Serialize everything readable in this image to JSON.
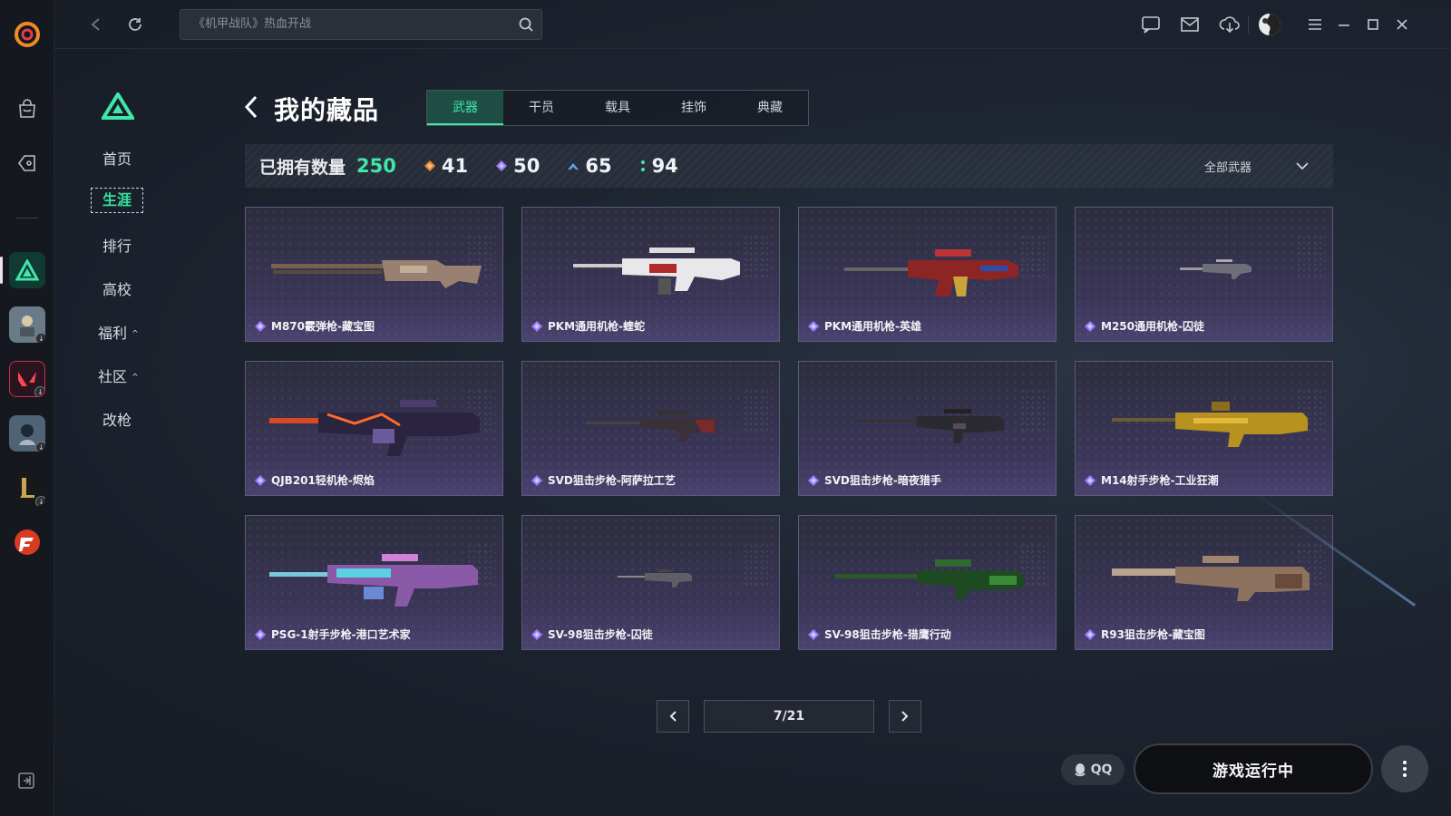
{
  "search": {
    "placeholder": "《机甲战队》热血开战"
  },
  "sidebar_nav": [
    {
      "label": "首页"
    },
    {
      "label": "生涯",
      "active": true
    },
    {
      "label": "排行"
    },
    {
      "label": "高校"
    },
    {
      "label": "福利",
      "expandable": true
    },
    {
      "label": "社区",
      "expandable": true
    },
    {
      "label": "改枪"
    }
  ],
  "header": {
    "title": "我的藏品"
  },
  "tabs": [
    {
      "label": "武器",
      "active": true
    },
    {
      "label": "干员"
    },
    {
      "label": "载具"
    },
    {
      "label": "挂饰"
    },
    {
      "label": "典藏"
    }
  ],
  "stats": {
    "owned_label": "已拥有数量",
    "owned_count": "250",
    "orange": "41",
    "purple": "50",
    "blue": "65",
    "green": "94",
    "filter": "全部武器"
  },
  "items": [
    {
      "name": "M870霰弹枪-藏宝图"
    },
    {
      "name": "PKM通用机枪-蝰蛇"
    },
    {
      "name": "PKM通用机枪-英雄"
    },
    {
      "name": "M250通用机枪-囚徒"
    },
    {
      "name": "QJB201轻机枪-烬焰"
    },
    {
      "name": "SVD狙击步枪-阿萨拉工艺"
    },
    {
      "name": "SVD狙击步枪-暗夜猎手"
    },
    {
      "name": "M14射手步枪-工业狂潮"
    },
    {
      "name": "PSG-1射手步枪-港口艺术家"
    },
    {
      "name": "SV-98狙击步枪-囚徒"
    },
    {
      "name": "SV-98狙击步枪-猎鹰行动"
    },
    {
      "name": "R93狙击步枪-藏宝图"
    }
  ],
  "pagination": {
    "page": "7/21"
  },
  "bottom": {
    "qq_label": "QQ",
    "status_button": "游戏运行中"
  },
  "colors": {
    "accent": "#3fe7a9",
    "purple_rarity": "#9b7bff",
    "card_bg": "#3b3658"
  }
}
